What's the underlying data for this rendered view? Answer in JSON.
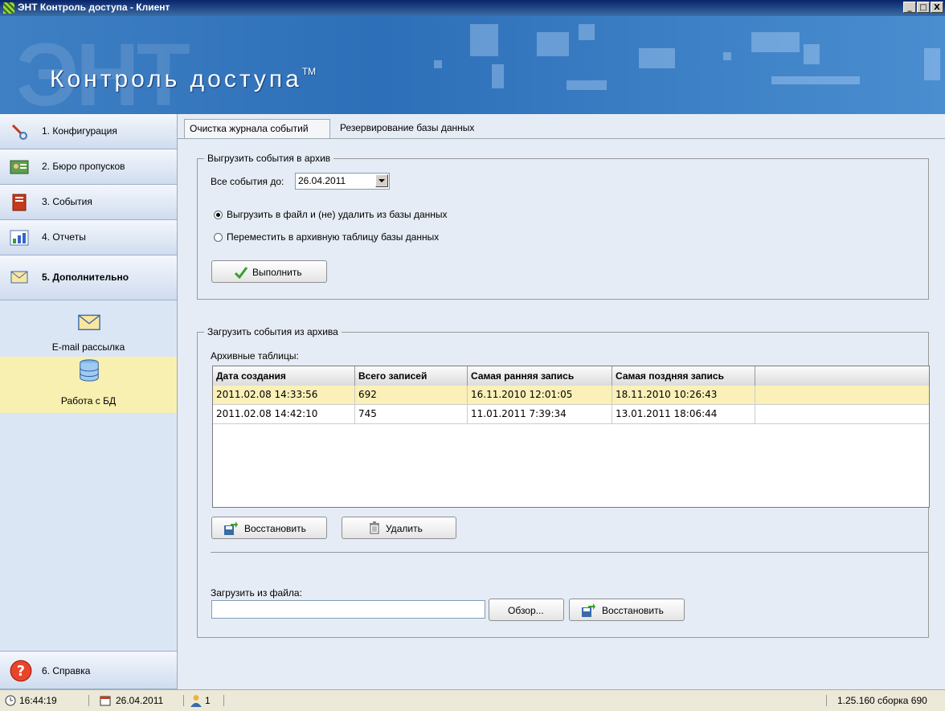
{
  "window": {
    "title": "ЭНТ Контроль доступа - Клиент",
    "min": "_",
    "max": "□",
    "close": "X"
  },
  "banner": {
    "bg_text": "ЭНТ",
    "title": "Контроль доступа",
    "tm": "TM"
  },
  "sidebar": {
    "items": [
      {
        "label": "1. Конфигурация",
        "icon": "wrench-icon"
      },
      {
        "label": "2. Бюро пропусков",
        "icon": "id-card-icon"
      },
      {
        "label": "3. События",
        "icon": "journal-icon"
      },
      {
        "label": "4. Отчеты",
        "icon": "chart-icon"
      },
      {
        "label": "5. Дополнительно",
        "icon": "envelope-icon"
      }
    ],
    "sub_items": [
      {
        "label": "E-mail рассылка",
        "icon": "envelope-icon"
      },
      {
        "label": "Работа с БД",
        "icon": "database-icon"
      }
    ],
    "help": {
      "label": "6. Справка",
      "icon": "help-icon"
    }
  },
  "tabs": [
    "Очистка журнала событий",
    "Резервирование базы данных"
  ],
  "export_group": {
    "legend": "Выгрузить события в архив",
    "date_label": "Все события до:",
    "date_value": "26.04.2011",
    "radio1": "Выгрузить в файл и (не) удалить из базы данных",
    "radio2": "Переместить в архивную таблицу базы данных",
    "execute": "Выполнить"
  },
  "import_group": {
    "legend": "Загрузить события из архива",
    "tables_label": "Архивные таблицы:",
    "columns": [
      "Дата создания",
      "Всего записей",
      "Самая ранняя запись",
      "Самая поздняя запись"
    ],
    "rows": [
      [
        "2011.02.08 14:33:56",
        "692",
        "16.11.2010 12:01:05",
        "18.11.2010 10:26:43"
      ],
      [
        "2011.02.08 14:42:10",
        "745",
        "11.01.2011 7:39:34",
        "13.01.2011 18:06:44"
      ]
    ],
    "restore": "Восстановить",
    "delete": "Удалить",
    "file_label": "Загрузить из файла:",
    "file_value": "",
    "browse": "Обзор...",
    "restore2": "Восстановить"
  },
  "status": {
    "time": "16:44:19",
    "date": "26.04.2011",
    "users": "1",
    "version": "1.25.160 сборка 690"
  },
  "colors": {
    "selected_row": "#faf0b8",
    "banner": "#3f80c4",
    "sidebar_selected": "#f8f0b0"
  }
}
